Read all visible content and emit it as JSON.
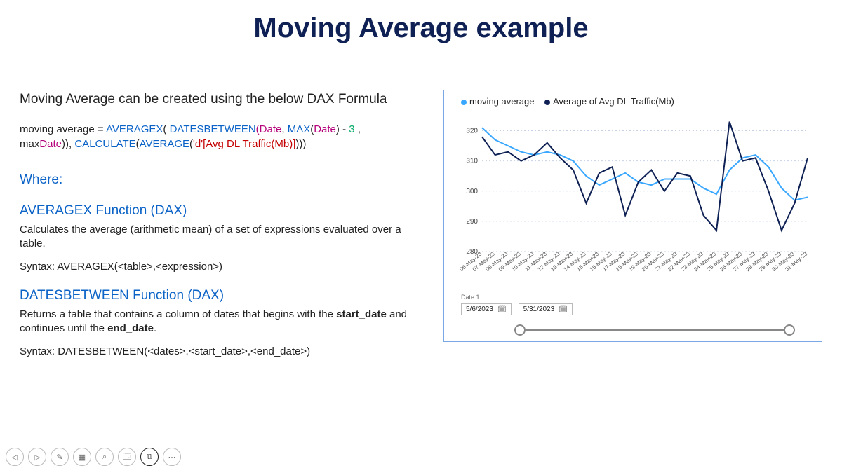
{
  "title": "Moving Average example",
  "intro": "Moving Average can be created using the below DAX Formula",
  "code": {
    "line1": {
      "a": "moving average = ",
      "b": "AVERAGEX",
      "c": "( ",
      "d": "DATESBETWEEN",
      "e": "(",
      "f": "Date",
      "g": ", ",
      "h": "MAX",
      "i": "(",
      "j": "Date",
      "k": ") - ",
      "l": "3",
      "m": " ,"
    },
    "line2": {
      "a": "max",
      "b": "Date",
      "c": ")), ",
      "d": "CALCULATE",
      "e": "(",
      "f": "AVERAGE",
      "g": "(",
      "h": "'d'[Avg DL Traffic(Mb)]",
      "i": ")))"
    }
  },
  "where": "Where:",
  "fn1": {
    "title": "AVERAGEX Function (DAX)",
    "desc": "Calculates the average (arithmetic mean) of a set of expressions evaluated over a table.",
    "syn": "Syntax: AVERAGEX(<table>,<expression>)"
  },
  "fn2": {
    "title": "DATESBETWEEN Function (DAX)",
    "desc_a": "Returns a table that contains a column of dates that begins with the ",
    "desc_b": "start_date",
    "desc_c": " and continues until the ",
    "desc_d": "end_date",
    "desc_e": ".",
    "syn": "Syntax: DATESBETWEEN(<dates>,<start_date>,<end_date>)"
  },
  "legend": {
    "a": "moving average",
    "b": "Average of Avg DL Traffic(Mb)"
  },
  "date1_label": "Date.1",
  "date_from": "5/6/2023",
  "date_to": "5/31/2023",
  "chart_data": {
    "type": "line",
    "xlabel": "",
    "ylabel": "",
    "ylim": [
      280,
      325
    ],
    "yticks": [
      280,
      290,
      300,
      310,
      320
    ],
    "categories": [
      "06-May-23",
      "07-May-23",
      "08-May-23",
      "09-May-23",
      "10-May-23",
      "11-May-23",
      "12-May-23",
      "13-May-23",
      "14-May-23",
      "15-May-23",
      "16-May-23",
      "17-May-23",
      "18-May-23",
      "19-May-23",
      "20-May-23",
      "21-May-23",
      "22-May-23",
      "23-May-23",
      "24-May-23",
      "25-May-23",
      "26-May-23",
      "27-May-23",
      "28-May-23",
      "29-May-23",
      "30-May-23",
      "31-May-23"
    ],
    "series": [
      {
        "name": "moving average",
        "color": "#3aa7ff",
        "values": [
          321,
          317,
          315,
          313,
          312,
          313,
          312,
          310,
          305,
          302,
          304,
          306,
          303,
          302,
          304,
          304,
          304,
          301,
          299,
          307,
          311,
          312,
          308,
          301,
          297,
          298
        ]
      },
      {
        "name": "Average of Avg DL Traffic(Mb)",
        "color": "#0f2154",
        "values": [
          318,
          312,
          313,
          310,
          312,
          316,
          311,
          307,
          296,
          306,
          308,
          292,
          303,
          307,
          300,
          306,
          305,
          292,
          287,
          323,
          310,
          311,
          300,
          287,
          296,
          311
        ]
      }
    ]
  },
  "toolbar": {
    "prev": "◁",
    "next": "▷",
    "pen": "✎",
    "grid": "▦",
    "zoom": "⌕",
    "cc": "🗔",
    "cam": "⧉",
    "more": "⋯"
  }
}
